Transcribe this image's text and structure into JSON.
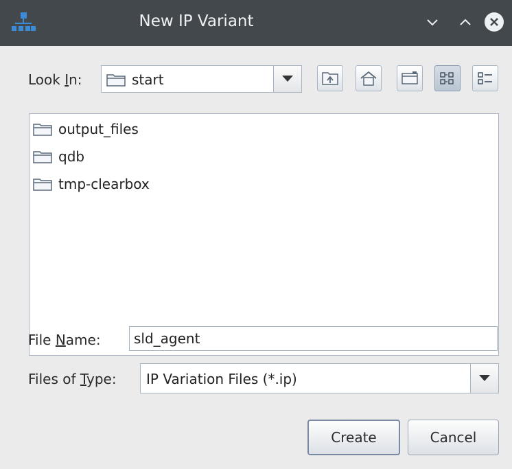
{
  "window": {
    "title": "New IP Variant",
    "icons": {
      "app": "network-hierarchy-icon",
      "minimize": "chevron-down-icon",
      "maximize": "chevron-up-icon",
      "close": "close-circle-icon"
    }
  },
  "look_in": {
    "label_prefix": "Look ",
    "label_mnemonic": "I",
    "label_suffix": "n:",
    "value": "start",
    "icon": "folder-icon"
  },
  "toolbar": {
    "buttons": [
      {
        "name": "up-one-level",
        "icon": "folder-up-icon"
      },
      {
        "name": "home",
        "icon": "home-icon"
      },
      {
        "name": "create-new-folder",
        "icon": "new-folder-icon"
      },
      {
        "name": "list-view",
        "icon": "list-view-icon",
        "active": true
      },
      {
        "name": "details-view",
        "icon": "details-view-icon",
        "active": false
      }
    ]
  },
  "files": [
    {
      "name": "output_files",
      "type": "folder"
    },
    {
      "name": "qdb",
      "type": "folder"
    },
    {
      "name": "tmp-clearbox",
      "type": "folder"
    }
  ],
  "file_name": {
    "label_prefix": "File ",
    "label_mnemonic": "N",
    "label_suffix": "ame:",
    "value": "sld_agent"
  },
  "files_of_type": {
    "label_prefix": "Files of ",
    "label_mnemonic": "T",
    "label_suffix": "ype:",
    "value": "IP Variation Files (*.ip)"
  },
  "buttons": {
    "create": "Create",
    "cancel": "Cancel"
  },
  "colors": {
    "titlebar": "#43484d",
    "dialog_bg": "#ebebeb",
    "border": "#a9b4c2",
    "accent": "#3b8bd6"
  }
}
